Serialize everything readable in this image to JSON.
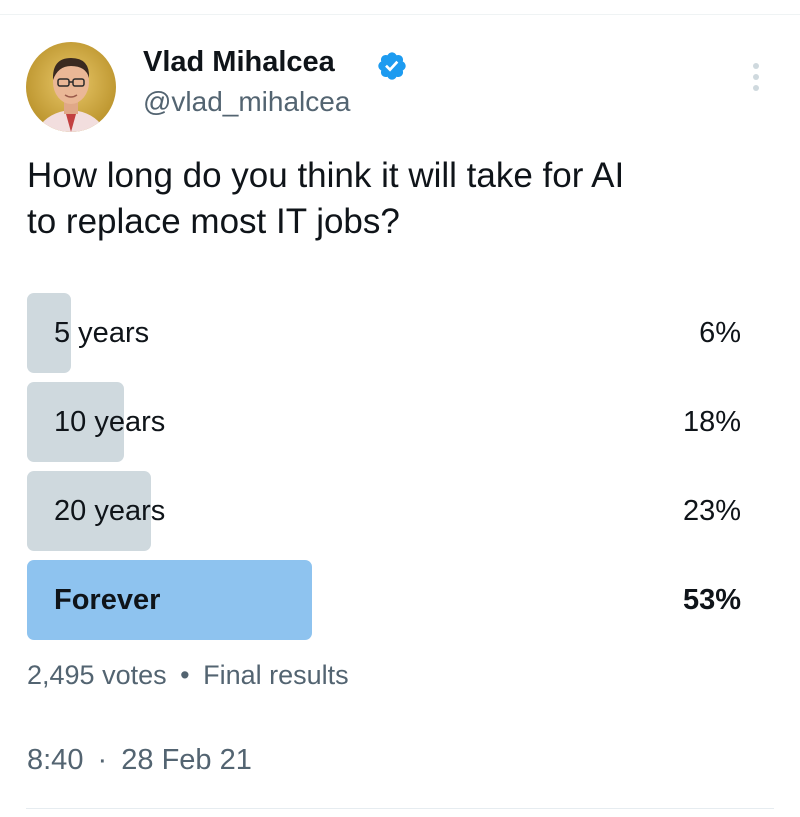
{
  "author": {
    "name": "Vlad Mihalcea",
    "handle": "@vlad_mihalcea"
  },
  "tweet": {
    "text_line1": "How long do you think it will take for AI",
    "text_line2": "to replace most IT jobs?"
  },
  "poll": {
    "options": [
      {
        "label": "5 years",
        "percent_text": "6%",
        "percent": 6,
        "winner": false
      },
      {
        "label": "10 years",
        "percent_text": "18%",
        "percent": 18,
        "winner": false
      },
      {
        "label": "20 years",
        "percent_text": "23%",
        "percent": 23,
        "winner": false
      },
      {
        "label": "Forever",
        "percent_text": "53%",
        "percent": 53,
        "winner": true
      }
    ],
    "votes": "2,495 votes",
    "separator": "•",
    "status": "Final results"
  },
  "meta": {
    "time": "8:40",
    "separator": "·",
    "date": "28 Feb 21"
  },
  "icons": {
    "verified": "verified-badge-icon",
    "more": "more-vertical-icon"
  },
  "colors": {
    "verified_blue": "#1d9bf0",
    "winner_bar": "#8ec3ef",
    "loser_bar": "#cfd9de",
    "secondary_text": "#536471"
  }
}
